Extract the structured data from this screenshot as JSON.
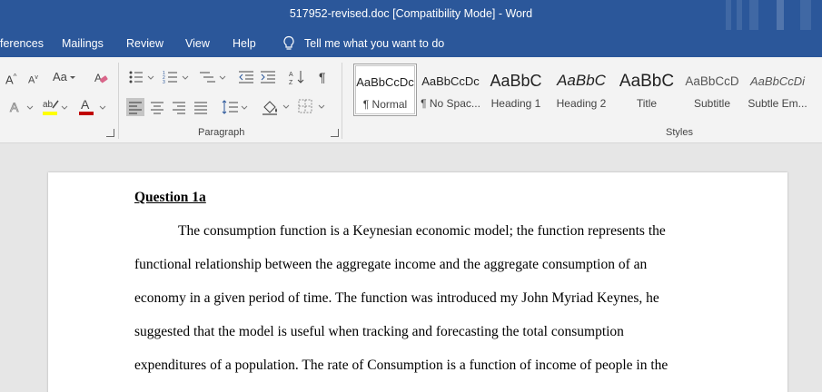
{
  "window": {
    "title": "517952-revised.doc [Compatibility Mode]  -  Word"
  },
  "ribbon_tabs": {
    "references": "ferences",
    "mailings": "Mailings",
    "review": "Review",
    "view": "View",
    "help": "Help",
    "tell_me": "Tell me what you want to do"
  },
  "ribbon": {
    "font_group": {
      "grow_font": "A",
      "shrink_font": "A",
      "change_case": "Aa"
    },
    "paragraph_group": {
      "label": "Paragraph"
    },
    "styles_group": {
      "label": "Styles",
      "items": [
        {
          "preview": "AaBbCcDc",
          "name": "¶ Normal",
          "selected": true
        },
        {
          "preview": "AaBbCcDc",
          "name": "¶ No Spac..."
        },
        {
          "preview": "AaBbC",
          "name": "Heading 1"
        },
        {
          "preview": "AaBbC",
          "name": "Heading 2"
        },
        {
          "preview": "AaBbC",
          "name": "Title"
        },
        {
          "preview": "AaBbCcD",
          "name": "Subtitle"
        },
        {
          "preview": "AaBbCcDi",
          "name": "Subtle Em..."
        }
      ]
    },
    "colors": {
      "highlight": "#ffff00",
      "font_color": "#c00000"
    }
  },
  "document": {
    "heading": "Question 1a",
    "lines": [
      "The consumption function is a Keynesian economic model; the function represents the",
      "functional relationship between the aggregate income and the aggregate consumption of an",
      "economy in a given period of time. The function was introduced my John Myriad Keynes, he",
      "suggested that the model is useful when tracking and forecasting the total consumption",
      "expenditures of a population. The rate of Consumption is a function of income of people in the"
    ]
  },
  "theme": {
    "accent": "#2b579a"
  }
}
